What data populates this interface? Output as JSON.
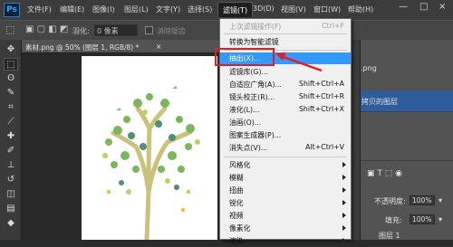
{
  "app": {
    "logo": "Ps"
  },
  "menubar": {
    "items": [
      "文件(F)",
      "编辑(E)",
      "图像(I)",
      "图层(L)",
      "文字(Y)",
      "选择(S)",
      "滤镜(T)",
      "3D(D)",
      "视图(V)",
      "窗口(W)",
      "帮助(H)"
    ],
    "active_index": 6,
    "window_buttons": [
      "—",
      "□",
      "×"
    ]
  },
  "options_bar": {
    "feather_label": "羽化:",
    "feather_value": "0 像素",
    "antialias_label": "消除锯齿"
  },
  "document": {
    "tab_title": "素材.png @ 50% (图层 1, RGB/8) *",
    "tab_close": "×"
  },
  "tools": [
    {
      "name": "move",
      "glyph": "✥"
    },
    {
      "name": "marquee",
      "glyph": "⬚"
    },
    {
      "name": "lasso",
      "glyph": "ʘ"
    },
    {
      "name": "quick-select",
      "glyph": "✎"
    },
    {
      "name": "crop",
      "glyph": "⌗"
    },
    {
      "name": "eyedropper",
      "glyph": "⟋"
    },
    {
      "name": "healing",
      "glyph": "✚"
    },
    {
      "name": "brush",
      "glyph": "✐"
    },
    {
      "name": "stamp",
      "glyph": "⊥"
    },
    {
      "name": "history-brush",
      "glyph": "↺"
    },
    {
      "name": "eraser",
      "glyph": "◫"
    },
    {
      "name": "gradient",
      "glyph": "▤"
    },
    {
      "name": "blur",
      "glyph": "◆"
    },
    {
      "name": "dodge",
      "glyph": "●"
    }
  ],
  "filter_menu": {
    "items": [
      {
        "label": "上次滤镜操作(F)",
        "shortcut": "Ctrl+F",
        "disabled": true
      },
      {
        "separator": true
      },
      {
        "label": "转换为智能滤镜"
      },
      {
        "separator": true
      },
      {
        "label": "抽出(X)...",
        "highlighted": true
      },
      {
        "label": "滤镜库(G)..."
      },
      {
        "label": "自适应广角(A)...",
        "shortcut": "Shift+Ctrl+A"
      },
      {
        "label": "镜头校正(R)...",
        "shortcut": "Shift+Ctrl+R"
      },
      {
        "label": "液化(L)...",
        "shortcut": "Shift+Ctrl+X"
      },
      {
        "label": "油画(O)..."
      },
      {
        "label": "图案生成器(P)..."
      },
      {
        "label": "消失点(V)...",
        "shortcut": "Alt+Ctrl+V"
      },
      {
        "separator": true
      },
      {
        "label": "风格化",
        "submenu": true
      },
      {
        "label": "模糊",
        "submenu": true
      },
      {
        "label": "扭曲",
        "submenu": true
      },
      {
        "label": "锐化",
        "submenu": true
      },
      {
        "label": "视频",
        "submenu": true
      },
      {
        "label": "像素化",
        "submenu": true
      },
      {
        "label": "渲染",
        "submenu": true
      }
    ]
  },
  "right_panel": {
    "file_item": ".png",
    "layer_copy_label": "拷贝的图层",
    "opacity_label": "不透明度:",
    "opacity_value": "100%",
    "fill_label": "填充:",
    "fill_value": "100%",
    "layer_name": "图层 1"
  },
  "colors": {
    "highlight": "#3399ff",
    "annotation_red": "#e02020",
    "menubar": "#3c3c3c"
  }
}
